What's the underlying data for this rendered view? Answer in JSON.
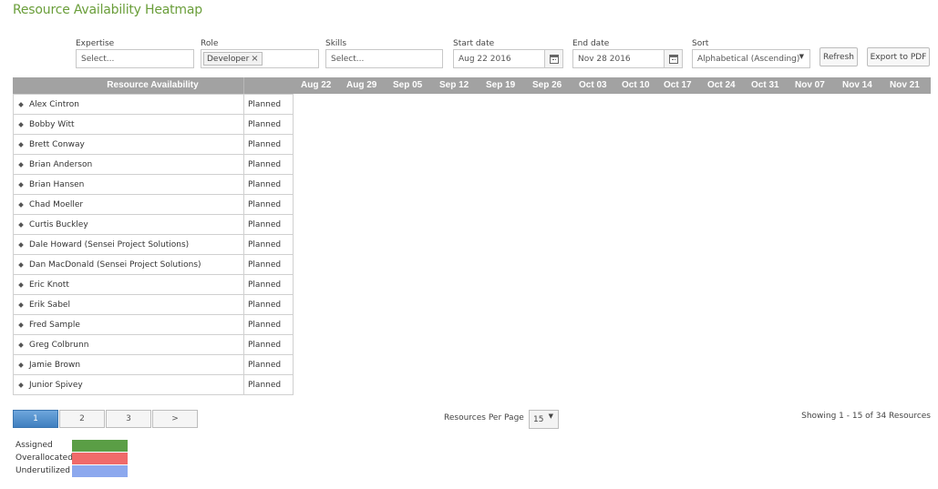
{
  "page": {
    "title": "Resource Availability Heatmap"
  },
  "filters": {
    "expertise": {
      "label": "Expertise",
      "placeholder": "Select..."
    },
    "role": {
      "label": "Role",
      "chip": "Developer",
      "remove_icon": "close-icon"
    },
    "skills": {
      "label": "Skills",
      "placeholder": "Select..."
    },
    "start_date": {
      "label": "Start date",
      "value": "Aug 22 2016",
      "icon": "calendar-icon"
    },
    "end_date": {
      "label": "End date",
      "value": "Nov 28 2016",
      "icon": "calendar-icon"
    },
    "sort": {
      "label": "Sort",
      "value": "Alphabetical (Ascending)",
      "icon": "caret-down-icon"
    }
  },
  "toolbar": {
    "refresh_label": "Refresh",
    "export_label": "Export to PDF"
  },
  "grid": {
    "header_title": "Resource Availability",
    "weeks": [
      "Aug 22",
      "Aug 29",
      "Sep 05",
      "Sep 12",
      "Sep 19",
      "Sep 26",
      "Oct 03",
      "Oct 10",
      "Oct 17",
      "Oct 24",
      "Oct 31",
      "Nov 07",
      "Nov 14",
      "Nov 21"
    ],
    "rows": [
      {
        "name": "Alex Cintron",
        "status": "Planned"
      },
      {
        "name": "Bobby Witt",
        "status": "Planned"
      },
      {
        "name": "Brett Conway",
        "status": "Planned"
      },
      {
        "name": "Brian Anderson",
        "status": "Planned"
      },
      {
        "name": "Brian Hansen",
        "status": "Planned"
      },
      {
        "name": "Chad Moeller",
        "status": "Planned"
      },
      {
        "name": "Curtis Buckley",
        "status": "Planned"
      },
      {
        "name": "Dale Howard (Sensei Project Solutions)",
        "status": "Planned"
      },
      {
        "name": "Dan MacDonald (Sensei Project Solutions)",
        "status": "Planned"
      },
      {
        "name": "Eric Knott",
        "status": "Planned"
      },
      {
        "name": "Erik Sabel",
        "status": "Planned"
      },
      {
        "name": "Fred Sample",
        "status": "Planned"
      },
      {
        "name": "Greg Colbrunn",
        "status": "Planned"
      },
      {
        "name": "Jamie Brown",
        "status": "Planned"
      },
      {
        "name": "Junior Spivey",
        "status": "Planned"
      }
    ]
  },
  "pagination": {
    "pages": [
      "1",
      "2",
      "3",
      ">"
    ],
    "active_page": "1",
    "per_page_label": "Resources Per Page",
    "per_page_value": "15",
    "showing": "Showing 1 - 15 of 34 Resources"
  },
  "legend": [
    {
      "label": "Assigned",
      "color": "#5a9e45"
    },
    {
      "label": "Overallocated",
      "color": "#f06a6a"
    },
    {
      "label": "Underutilized",
      "color": "#8ca8ee"
    }
  ]
}
